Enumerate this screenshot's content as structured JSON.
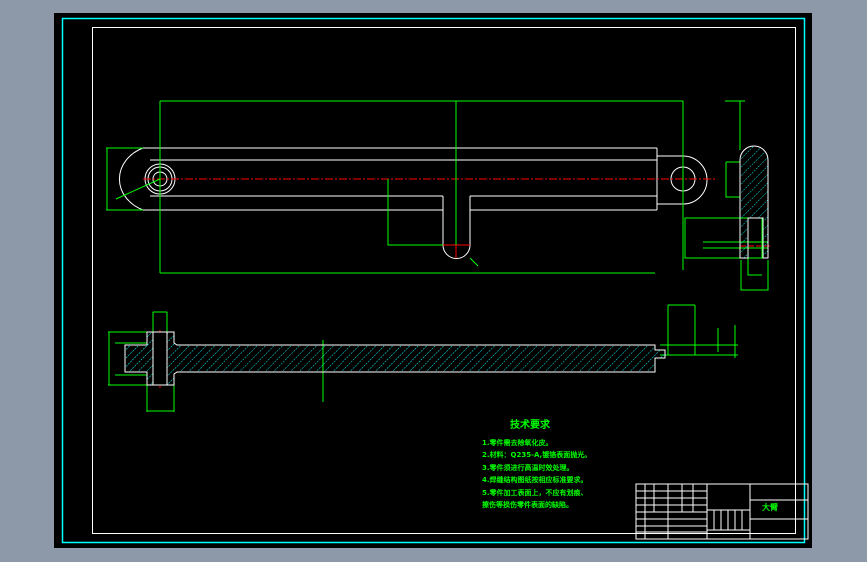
{
  "drawing": {
    "colors": {
      "background": "#8d99a9",
      "paper": "#000000",
      "frame": "#00ffff",
      "outline": "#ffffff",
      "dimension": "#00ff00",
      "centerline": "#ff0000",
      "hatch": "#00ffff"
    },
    "technical_requirements": {
      "title": "技术要求",
      "items": [
        "1.零件需去除氧化皮。",
        "2.材料：Q235-A,镀铬表面抛光。",
        "3.零件须进行高温时效处理。",
        "4.焊缝结构图纸按相应标准要求。",
        "5.零件加工表面上，不应有划痕、",
        "擦伤等损伤零件表面的缺陷。"
      ]
    },
    "title_block": {
      "part_name": "大臂"
    }
  }
}
